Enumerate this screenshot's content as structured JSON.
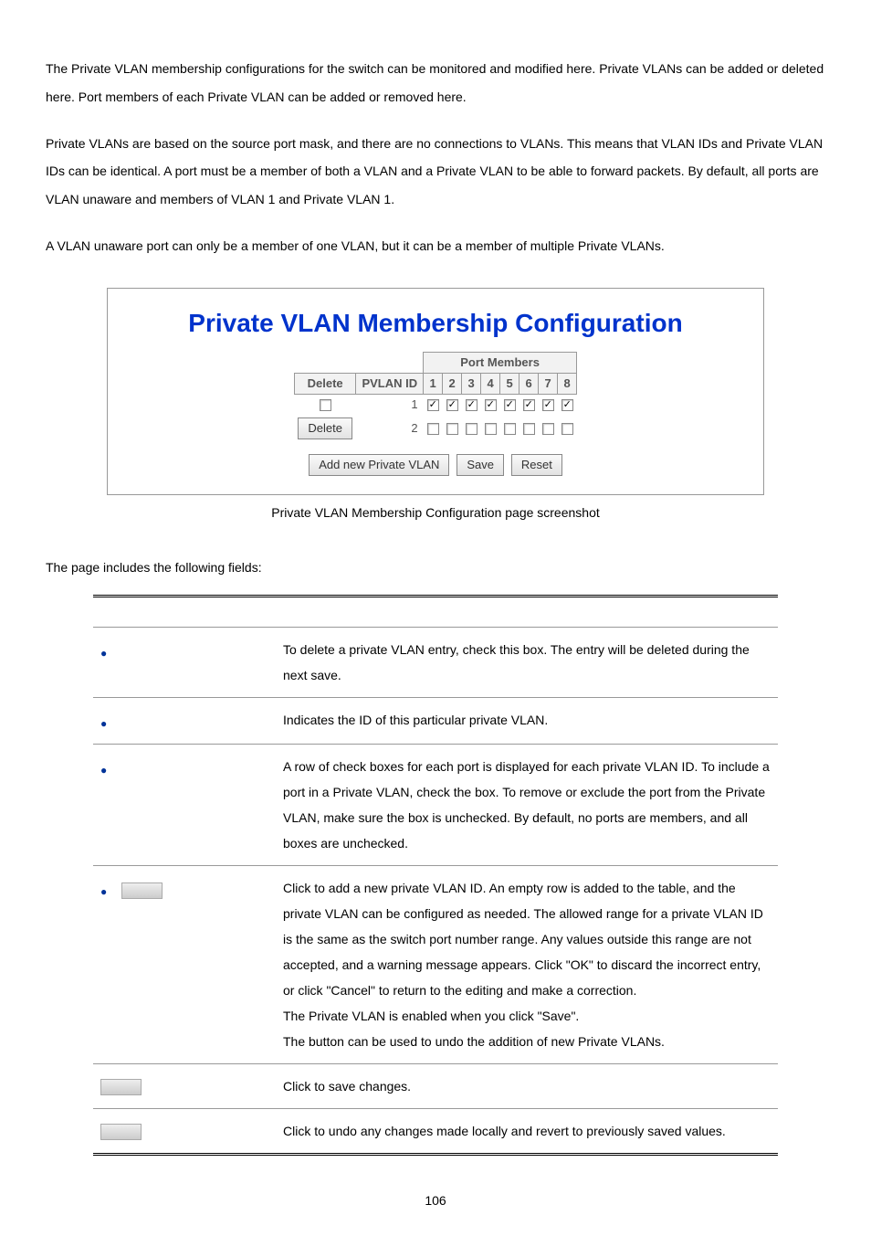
{
  "para1": "The Private VLAN membership configurations for the switch can be monitored and modified here. Private VLANs can be added or deleted here. Port members of each Private VLAN can be added or removed here.",
  "para2": "Private VLANs are based on the source port mask, and there are no connections to VLANs. This means that VLAN IDs and Private VLAN IDs can be identical. A port must be a member of both a VLAN and a Private VLAN to be able to forward packets. By default, all ports are VLAN unaware and members of VLAN 1 and Private VLAN 1.",
  "para3": "A VLAN unaware port can only be a member of one VLAN, but it can be a member of multiple Private VLANs.",
  "screenshot": {
    "title": "Private VLAN Membership Configuration",
    "portMembersHeader": "Port Members",
    "deleteHeader": "Delete",
    "pvlanIdHeader": "PVLAN ID",
    "ports": [
      "1",
      "2",
      "3",
      "4",
      "5",
      "6",
      "7",
      "8"
    ],
    "rows": [
      {
        "delete": {
          "type": "checkbox",
          "checked": false
        },
        "id": "1",
        "members": [
          true,
          true,
          true,
          true,
          true,
          true,
          true,
          true
        ]
      },
      {
        "delete": {
          "type": "button",
          "label": "Delete"
        },
        "id": "2",
        "members": [
          false,
          false,
          false,
          false,
          false,
          false,
          false,
          false
        ]
      }
    ],
    "buttons": {
      "addNew": "Add new Private VLAN",
      "save": "Save",
      "reset": "Reset"
    }
  },
  "caption": "Private VLAN Membership Configuration page screenshot",
  "fieldsIntro": "The page includes the following fields:",
  "fieldsTable": {
    "rows": [
      {
        "desc": "To delete a private VLAN entry, check this box. The entry will be deleted during the next save."
      },
      {
        "desc": "Indicates the ID of this particular private VLAN."
      },
      {
        "desc": "A row of check boxes for each port is displayed for each private VLAN ID. To include a port in a Private VLAN, check the box. To remove or exclude the port from the Private VLAN, make sure the box is unchecked. By default, no ports are members, and all boxes are unchecked."
      },
      {
        "desc": "Click to add a new private VLAN ID. An empty row is added to the table, and the private VLAN can be configured as needed. The allowed range for a private VLAN ID is the same as the switch port number range. Any values outside this range are not accepted, and a warning message appears. Click \"OK\" to discard the incorrect entry, or click \"Cancel\" to return to the editing and make a correction.\nThe Private VLAN is enabled when you click \"Save\".\nThe button can be used to undo the addition of new Private VLANs."
      },
      {
        "desc": "Click to save changes."
      },
      {
        "desc": "Click to undo any changes made locally and revert to previously saved values."
      }
    ]
  },
  "pageNum": "106",
  "chart_data": {
    "type": "table",
    "title": "Private VLAN Membership Configuration",
    "columns": [
      "Delete",
      "PVLAN ID",
      "Port 1",
      "Port 2",
      "Port 3",
      "Port 4",
      "Port 5",
      "Port 6",
      "Port 7",
      "Port 8"
    ],
    "rows": [
      [
        "unchecked",
        "1",
        "checked",
        "checked",
        "checked",
        "checked",
        "checked",
        "checked",
        "checked",
        "checked"
      ],
      [
        "Delete (button)",
        "2",
        "unchecked",
        "unchecked",
        "unchecked",
        "unchecked",
        "unchecked",
        "unchecked",
        "unchecked",
        "unchecked"
      ]
    ]
  }
}
